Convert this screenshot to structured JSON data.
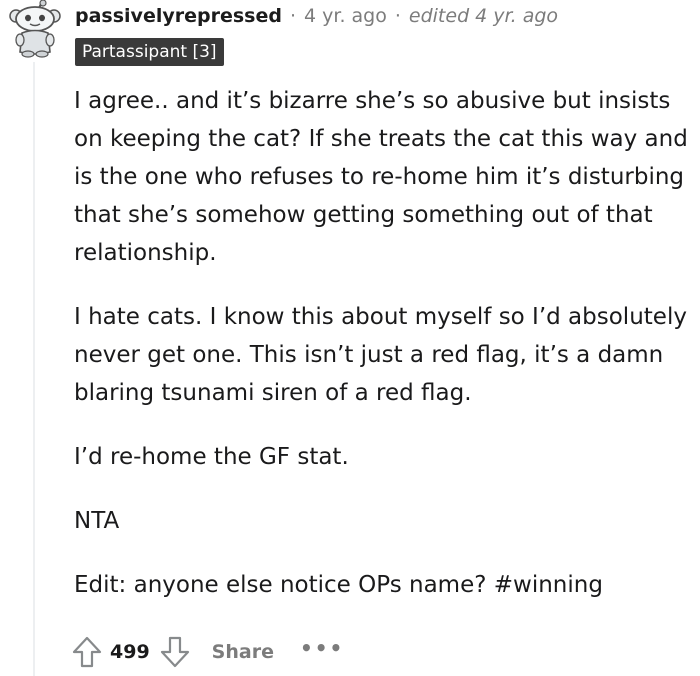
{
  "comment": {
    "username": "passivelyrepressed",
    "time": "4 yr. ago",
    "edited": "edited 4 yr. ago",
    "separator": "·",
    "flair": "Partassipant [3]",
    "paragraphs": [
      "I agree.. and it’s bizarre she’s so abusive but insists on keeping the cat? If she treats the cat this way and is the one who refuses to re-home him it’s disturbing that she’s somehow getting something out of that relationship.",
      "I hate cats. I know this about myself so I’d absolutely never get one. This isn’t just a red flag, it’s a damn blaring tsunami siren of a red flag.",
      "I’d re-home the GF stat.",
      "NTA",
      "Edit: anyone else notice OPs name? #winning"
    ],
    "actions": {
      "upvote_icon": "upvote-arrow-icon",
      "score": "499",
      "downvote_icon": "downvote-arrow-icon",
      "share_label": "Share",
      "more_label": "•••"
    }
  },
  "colors": {
    "flair_bg": "#3a3a3a",
    "meta_gray": "#7c7c7c",
    "thread_line": "#edeff1"
  }
}
